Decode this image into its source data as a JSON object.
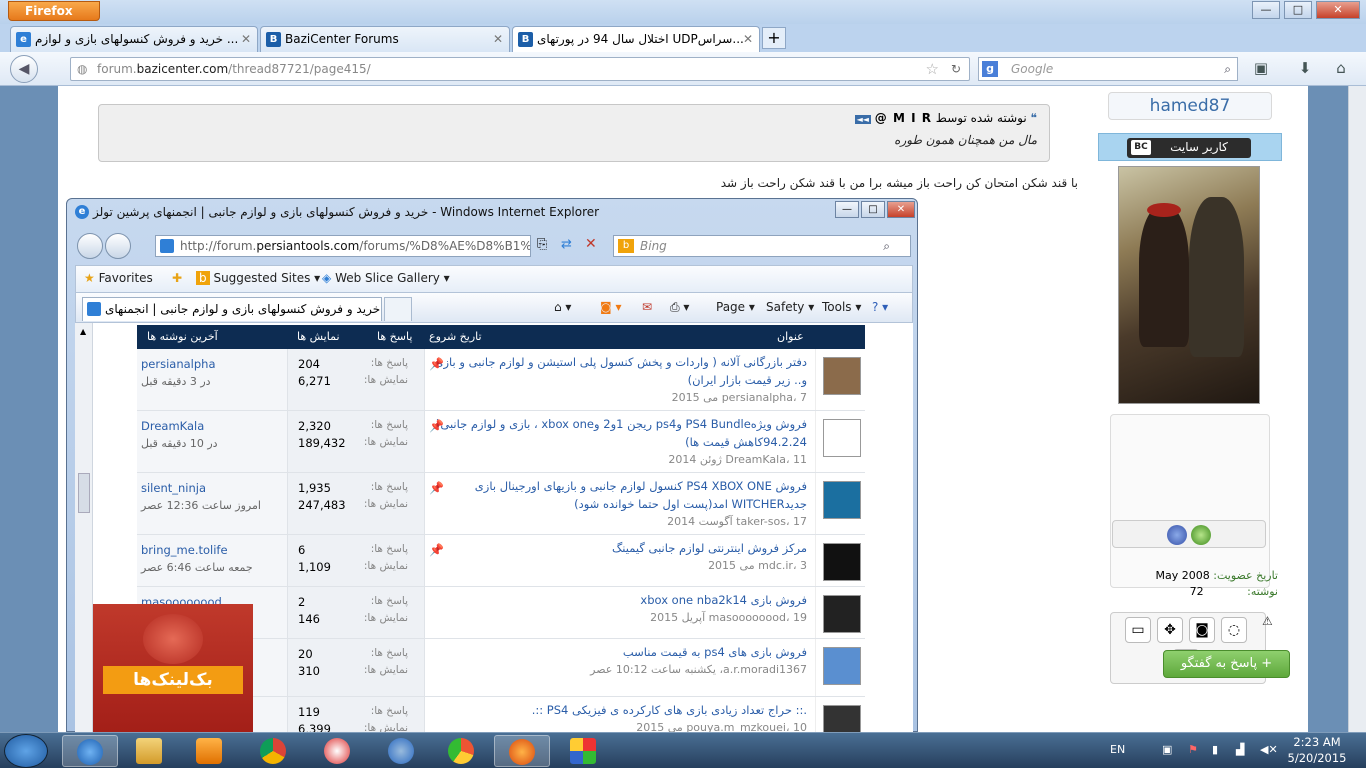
{
  "firefox": {
    "menu_label": "Firefox",
    "tabs": [
      {
        "title": "خرید و فروش کنسولهای بازی و لوازم ...",
        "fav": "IE"
      },
      {
        "title": "BaziCenter Forums",
        "fav": "B"
      },
      {
        "title": "اختلال سال 94 در پورتهای UDPسراس...",
        "fav": "B"
      }
    ],
    "url_prefix": "forum.",
    "url_domain": "bazicenter.com",
    "url_path": "/thread87721/page415/",
    "search_placeholder": "Google"
  },
  "post": {
    "quote_header": "نوشته شده توسط",
    "quote_author": "M I R @",
    "quote_text": "مال من همچنان همون طوره",
    "reply_text": "با قند شکن امتحان کن راحت باز میشه برا من با قند شکن راحت باز شد"
  },
  "user": {
    "name": "hamed87",
    "rank": "کاربر سایت",
    "rank_badge": "BC",
    "join_label": "تاریخ عضویت:",
    "join_value": "May 2008",
    "posts_label": "نوشته:",
    "posts_value": "72"
  },
  "reply_button": "+ پاسخ به گفتگو",
  "ie": {
    "title": "خرید و فروش کنسولهای بازی و لوازم جانبی | انجمنهای پرشین تولز - Windows Internet Explorer",
    "address_prefix": "http://forum.",
    "address_domain": "persiantools.com",
    "address_path": "/forums/%D8%AE%D8%B1%DB",
    "search_placeholder": "Bing",
    "fav_label": "Favorites",
    "suggested_label": "Suggested Sites",
    "webslice_label": "Web Slice Gallery",
    "tab_title": "خرید و فروش کنسولهای بازی و لوازم جانبی | انجمنهای ...",
    "cmd_page": "Page",
    "cmd_safety": "Safety",
    "cmd_tools": "Tools",
    "columns": {
      "title": "عنوان",
      "start_date": "تاریخ شروع",
      "replies": "پاسخ ها",
      "views": "نمایش ها",
      "last_post": "آخرین نوشته ها"
    },
    "stat_labels": {
      "replies": "پاسخ ها:",
      "views": "نمایش ها:"
    },
    "threads": [
      {
        "title": "دفتر بازرگانی آلانه ( واردات و پخش کنسول پلی استیشن و لوازم جانبی و بازی و.. زیر قیمت بازار ایران)",
        "meta": "persianalpha، 7 می 2015",
        "replies": "204",
        "views": "6,271",
        "last_user": "persianalpha",
        "last_time": "در 3 دقیقه قبل",
        "pinned": true
      },
      {
        "title": "فروش ویژهPS4 Bundle وps4 ریجن 1و2 وxbox one ، بازی و لوازم جانبی( 94.2.24کاهش قیمت ها)",
        "meta": "DreamKala، 11 ژوئن 2014",
        "replies": "2,320",
        "views": "189,432",
        "last_user": "DreamKala",
        "last_time": "در 10 دقیقه قبل",
        "pinned": true
      },
      {
        "title": "فروش PS4 XBOX ONE کنسول لوازم جانبی و بازیهای اورجینال بازی جدیدWITCHER امد(پست اول حتما خوانده شود)",
        "meta": "taker-sos، 17 آگوست 2014",
        "replies": "1,935",
        "views": "247,483",
        "last_user": "silent_ninja",
        "last_time": "امروز ساعت 12:36 عصر",
        "pinned": true
      },
      {
        "title": "مرکز فروش اینترنتی لوازم جانبی گیمینگ",
        "meta": "mdc.ir، 3 می 2015",
        "replies": "6",
        "views": "1,109",
        "last_user": "bring_me.tolife",
        "last_time": "جمعه ساعت 6:46 عصر",
        "pinned": true
      },
      {
        "title": "فروش بازی xbox one nba2k14",
        "meta": "masoooooood، 19 آپریل 2015",
        "replies": "2",
        "views": "146",
        "last_user": "masoooooood",
        "last_time": "",
        "pinned": false
      },
      {
        "title": "فروش بازی های ps4 به قیمت مناسب",
        "meta": "a.r.moradi1367، یکشنبه ساعت 10:12 عصر",
        "replies": "20",
        "views": "310",
        "last_user": "",
        "last_time": "",
        "pinned": false
      },
      {
        "title": ".:: حراج تعداد زیادی بازی های کارکرده ی فیزیکی PS4 ::.",
        "meta": "pouya.m_mzkouei، 10 می 2015",
        "replies": "119",
        "views": "6,399",
        "last_user": "",
        "last_time": "",
        "pinned": false
      }
    ]
  },
  "promo_text": "بک‌لینک‌ها",
  "taskbar": {
    "lang": "EN",
    "time": "2:23 AM",
    "date": "5/20/2015"
  },
  "colors": {
    "ie_header": "#0d2c52",
    "link": "#2a5da8",
    "reply_btn": "#5ea83b",
    "ff_menu": "#e6791b"
  }
}
